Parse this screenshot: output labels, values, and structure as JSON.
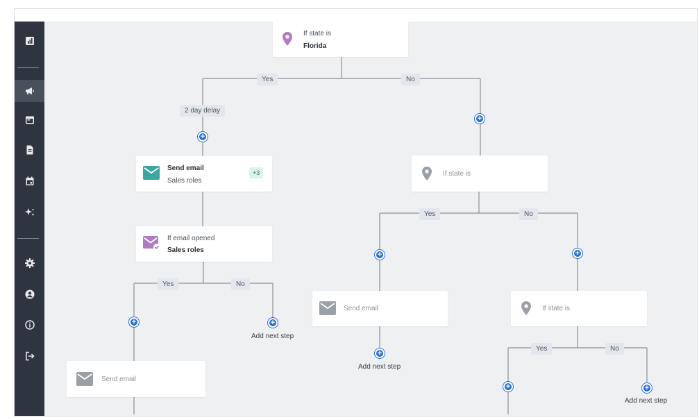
{
  "sidebar": {
    "items": [
      {
        "icon": "chart-icon"
      },
      {
        "icon": "megaphone-icon",
        "active": true
      },
      {
        "icon": "calendar-window-icon"
      },
      {
        "icon": "document-icon"
      },
      {
        "icon": "calendar-icon"
      },
      {
        "icon": "sparkle-icon"
      },
      {
        "icon": "gear-icon"
      },
      {
        "icon": "user-icon"
      },
      {
        "icon": "info-icon"
      },
      {
        "icon": "logout-icon"
      }
    ]
  },
  "workflow": {
    "root": {
      "label": "If state is",
      "value": "Florida"
    },
    "branch_yes": "Yes",
    "branch_no": "No",
    "delay": "2 day delay",
    "send_email_1": {
      "title": "Send email",
      "subtitle": "Sales roles",
      "badge": "+3"
    },
    "if_email_opened": {
      "label": "If email opened",
      "value": "Sales roles"
    },
    "send_email_2": {
      "title": "Send email"
    },
    "if_state_2": {
      "label": "If state is"
    },
    "send_email_3": {
      "title": "Send email"
    },
    "if_state_3": {
      "label": "If state is"
    },
    "add_next_step": "Add next step"
  },
  "colors": {
    "sidebar": "#2f3540",
    "canvas": "#eef0f2",
    "plus": "#2a6fd6",
    "location_purple": "#b07cc6",
    "email_teal": "#3aa6a0",
    "muted_icon": "#9aa0a6"
  }
}
